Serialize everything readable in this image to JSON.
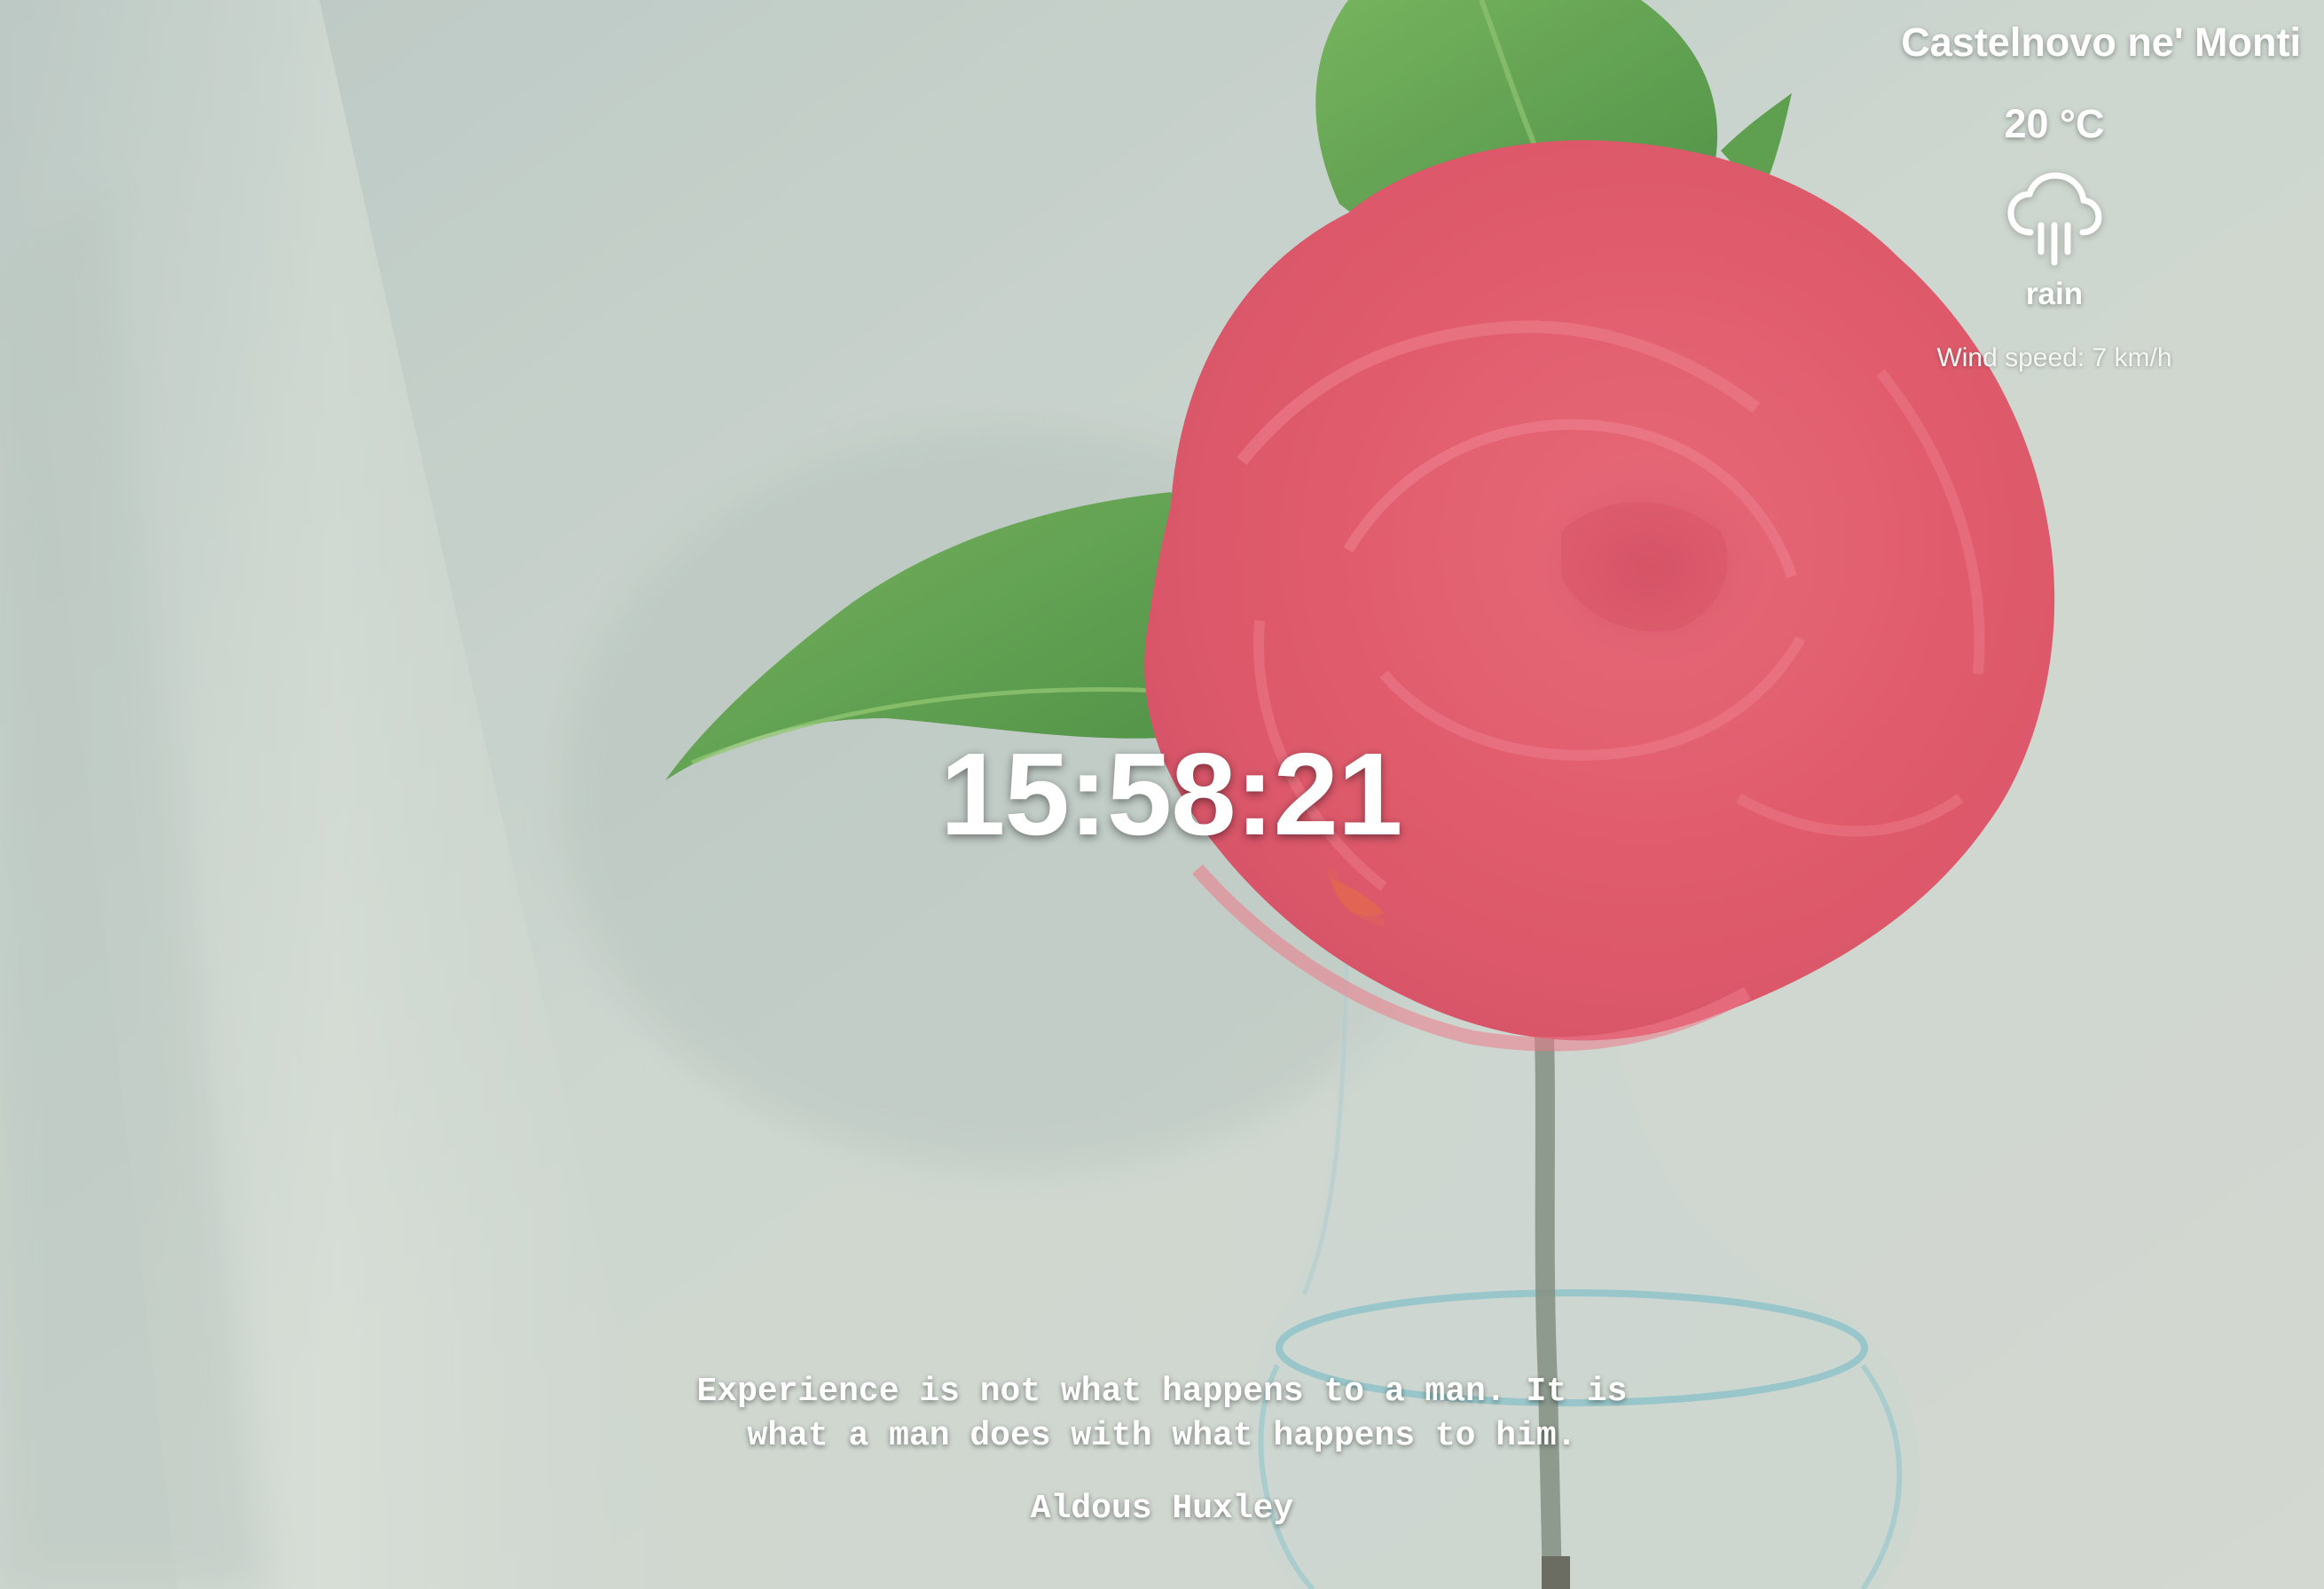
{
  "colors": {
    "background": "#c9d2cc",
    "flower": "#e2485e",
    "leaf": "#4f9a3f",
    "text": "#ffffff"
  },
  "weather": {
    "city": "Castelnovo ne' Monti",
    "temperature": "20 °C",
    "icon": "rain-cloud-icon",
    "condition": "rain",
    "wind": "Wind speed: 7 km/h"
  },
  "clock": {
    "time": "15:58:21"
  },
  "quote": {
    "text_line1": "Experience is not what happens to a man. It is",
    "text_line2": "what a man does with what happens to him.",
    "author": "Aldous Huxley"
  }
}
